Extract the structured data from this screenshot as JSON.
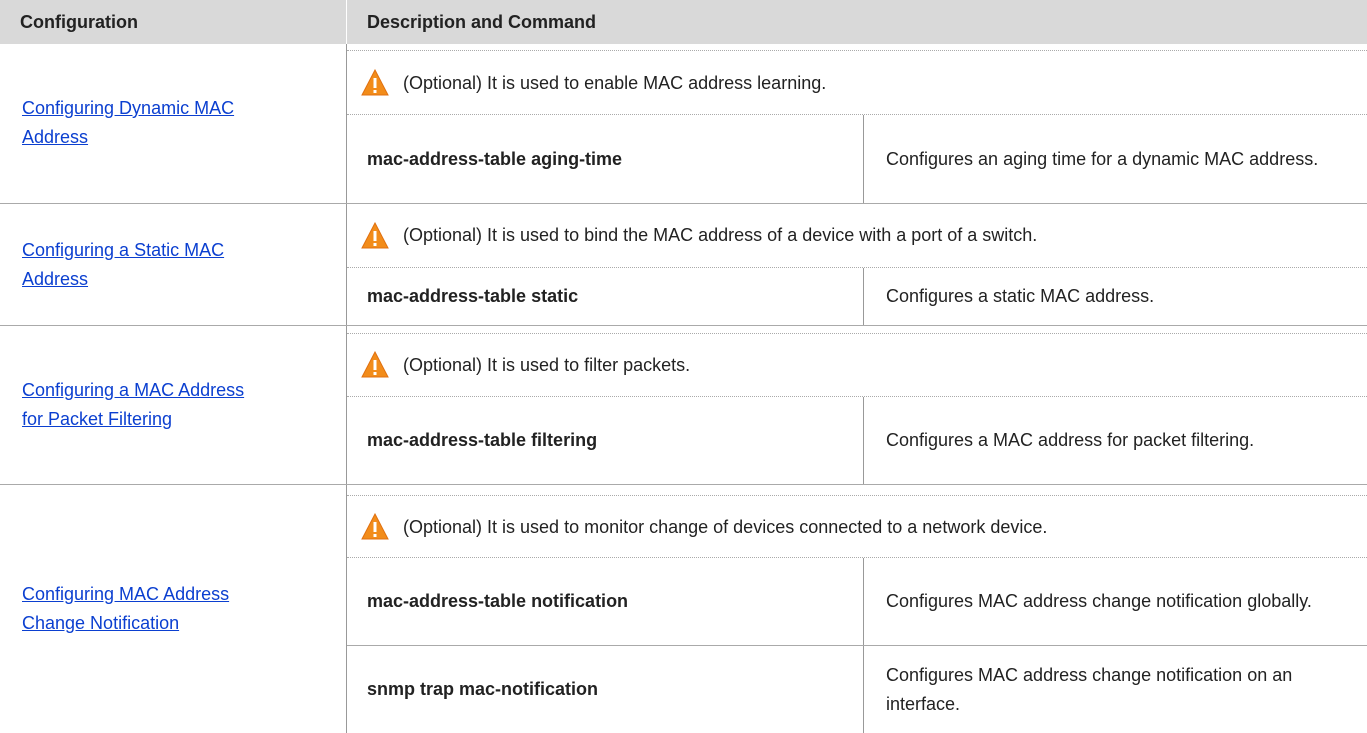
{
  "headers": {
    "configuration": "Configuration",
    "description": "Description and Command"
  },
  "rows": [
    {
      "link": "Configuring Dynamic MAC Address",
      "link_line1": "Configuring Dynamic MAC ",
      "link_line2": "Address",
      "note": "(Optional) It is used to enable MAC address learning.",
      "commands": [
        {
          "command": "mac-address-table aging-time",
          "description": "Configures an aging time for a dynamic MAC address."
        }
      ]
    },
    {
      "link": "Configuring a Static MAC Address",
      "link_line1": "Configuring a Static MAC ",
      "link_line2": "Address",
      "note": "(Optional) It is used to bind the MAC address of a device with a port of a switch.",
      "commands": [
        {
          "command": "mac-address-table static",
          "description": "Configures a static MAC address."
        }
      ]
    },
    {
      "link": "Configuring a MAC Address for Packet Filtering",
      "link_line1": "Configuring a MAC Address ",
      "link_line2": "for Packet Filtering",
      "note": "(Optional) It is used to filter packets.",
      "commands": [
        {
          "command": "mac-address-table filtering",
          "description": "Configures a MAC address for packet filtering."
        }
      ]
    },
    {
      "link": "Configuring MAC Address Change Notification",
      "link_line1": "Configuring MAC Address ",
      "link_line2": "Change Notification",
      "note": "(Optional) It is used to monitor change of devices connected to a network device.",
      "commands": [
        {
          "command": "mac-address-table notification",
          "description": "Configures MAC address change notification globally."
        },
        {
          "command": "snmp trap mac-notification",
          "description": "Configures MAC address change notification on an interface."
        }
      ]
    }
  ],
  "icons": {
    "warning": "warning-triangle-icon"
  },
  "colors": {
    "header_bg": "#d9d9d9",
    "link": "#0b3fd0",
    "warning_orange": "#f28c1a"
  }
}
